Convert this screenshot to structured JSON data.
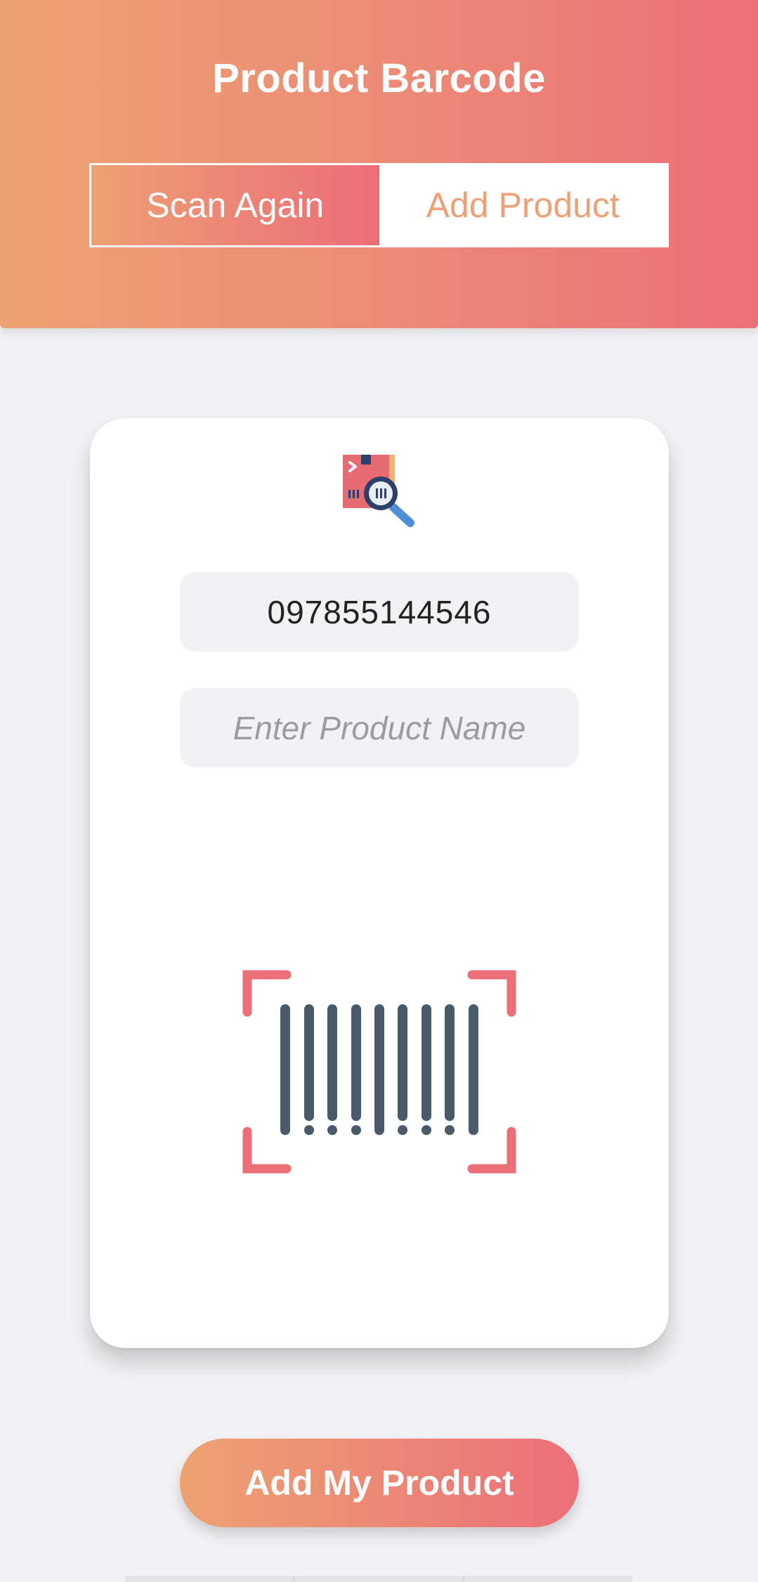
{
  "header": {
    "title": "Product Barcode",
    "tabs": [
      {
        "label": "Scan Again",
        "active": true
      },
      {
        "label": "Add Product",
        "active": false
      }
    ]
  },
  "form": {
    "barcode_value": "097855144546",
    "product_name_value": "",
    "product_name_placeholder": "Enter Product Name"
  },
  "icons": {
    "product": "product-search-icon",
    "scanner": "barcode-scan-icon"
  },
  "actions": {
    "submit_label": "Add My Product"
  },
  "colors": {
    "gradient_start": "#eda272",
    "gradient_end": "#ec6f78",
    "barcode_bars": "#4a5a68",
    "scan_corners": "#ec6f78",
    "background": "#f2f2f4"
  }
}
